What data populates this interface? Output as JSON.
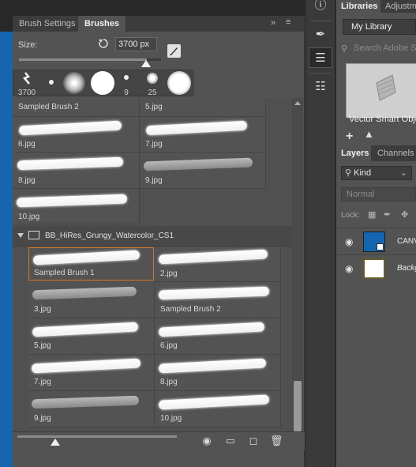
{
  "brush_panel": {
    "tabs": [
      "Brush Settings",
      "Brushes"
    ],
    "active_tab": "Brushes",
    "size_label": "Size:",
    "size_value": "3700 px",
    "recent_tips": [
      "3700",
      "",
      "",
      "",
      "9",
      "25",
      ""
    ],
    "list_top": [
      {
        "label": "Sampled Brush 2",
        "stroke": ""
      },
      {
        "label": "5.jpg",
        "stroke": ""
      },
      {
        "label": "6.jpg",
        "stroke": "white"
      },
      {
        "label": "7.jpg",
        "stroke": "white"
      },
      {
        "label": "8.jpg",
        "stroke": "white"
      },
      {
        "label": "9.jpg",
        "stroke": "gray"
      },
      {
        "label": "10.jpg",
        "stroke": "white"
      }
    ],
    "group_name": "BB_HiRes_Grungy_Watercolor_CS1",
    "group_items": [
      {
        "label": "Sampled Brush 1",
        "stroke": "white",
        "selected": true
      },
      {
        "label": "2.jpg",
        "stroke": "white"
      },
      {
        "label": "3.jpg",
        "stroke": "gray"
      },
      {
        "label": "Sampled Brush 2",
        "stroke": "white"
      },
      {
        "label": "5.jpg",
        "stroke": "white"
      },
      {
        "label": "6.jpg",
        "stroke": "white"
      },
      {
        "label": "7.jpg",
        "stroke": "white"
      },
      {
        "label": "8.jpg",
        "stroke": "white"
      },
      {
        "label": "9.jpg",
        "stroke": "gray"
      },
      {
        "label": "10.jpg",
        "stroke": "white"
      }
    ]
  },
  "libraries": {
    "tabs": [
      "Libraries",
      "Adjustm"
    ],
    "selected_library": "My Library",
    "search_placeholder": "Search Adobe S",
    "asset_label": "Vector Smart Obje"
  },
  "layers": {
    "tabs": [
      "Layers",
      "Channels"
    ],
    "kind_filter": "Kind",
    "blend_mode": "Normal",
    "lock_label": "Lock:",
    "items": [
      {
        "name": "CANV",
        "thumb_color": "#1565b0"
      },
      {
        "name": "Backg",
        "thumb_color": "#ffffff"
      }
    ]
  },
  "colors": {
    "accent_selection": "#d4782e",
    "canvas_blue": "#1565b0"
  }
}
